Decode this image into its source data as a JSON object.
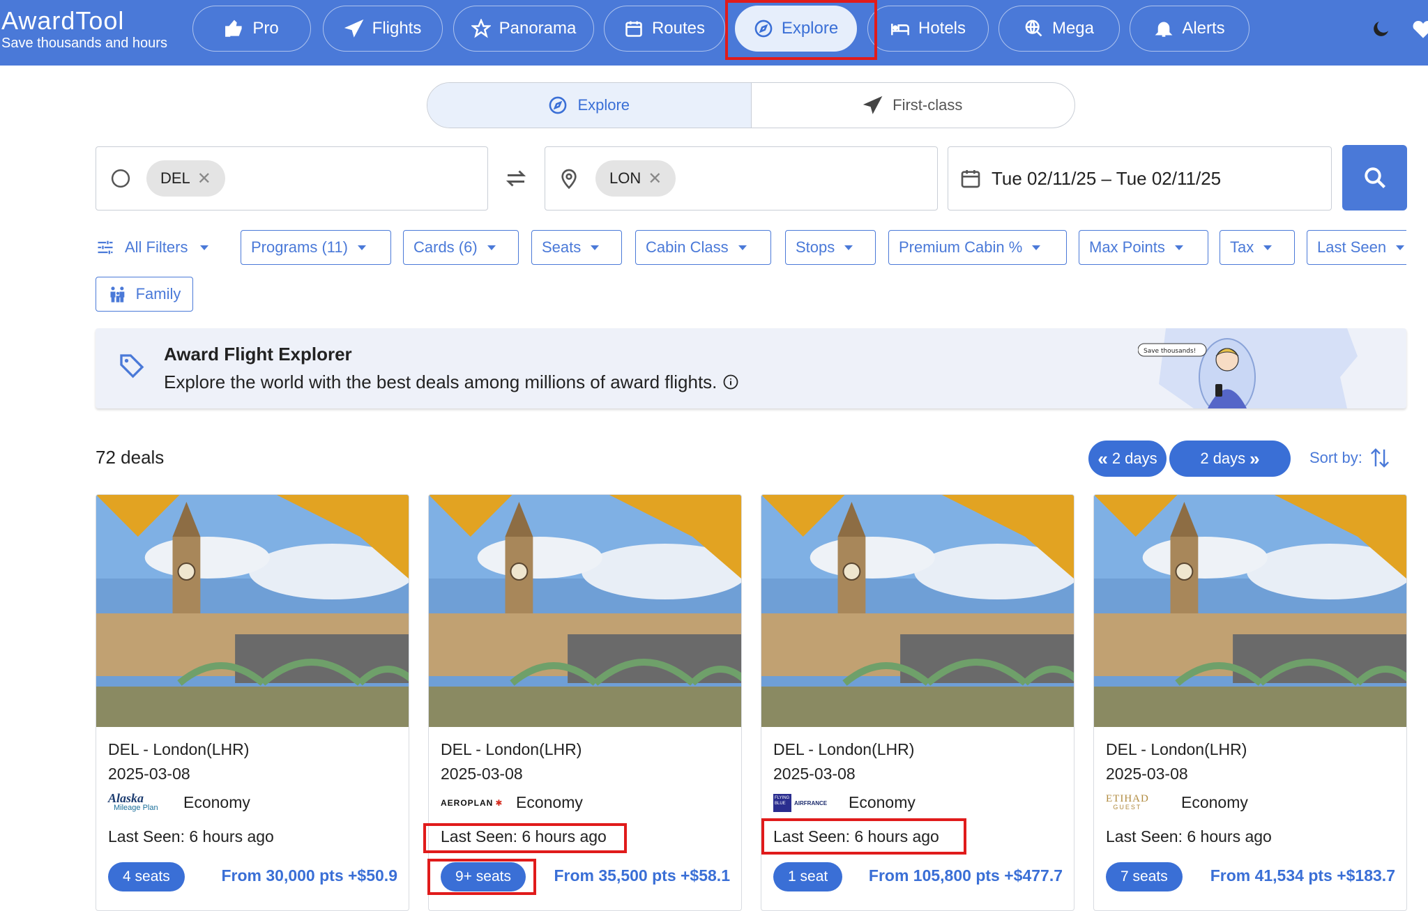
{
  "brand": {
    "title": "AwardTool",
    "subtitle": "Save thousands and hours"
  },
  "nav": [
    {
      "label": "Pro",
      "icon": "thumbs-up-icon"
    },
    {
      "label": "Flights",
      "icon": "plane-icon"
    },
    {
      "label": "Panorama",
      "icon": "star-icon"
    },
    {
      "label": "Routes",
      "icon": "calendar-icon"
    },
    {
      "label": "Explore",
      "icon": "compass-icon",
      "active": true
    },
    {
      "label": "Hotels",
      "icon": "bed-icon"
    },
    {
      "label": "Mega",
      "icon": "globe-search-icon"
    },
    {
      "label": "Alerts",
      "icon": "bell-icon"
    }
  ],
  "mode_toggle": {
    "explore_label": "Explore",
    "first_class_label": "First-class"
  },
  "search": {
    "origin_chip": "DEL",
    "destination_chip": "LON",
    "date_range": "Tue 02/11/25 – Tue 02/11/25"
  },
  "filters": {
    "all_filters": "All Filters",
    "items": [
      "Programs (11)",
      "Cards (6)",
      "Seats",
      "Cabin Class",
      "Stops",
      "Premium Cabin %",
      "Max Points",
      "Tax",
      "Last Seen"
    ],
    "family": "Family"
  },
  "banner": {
    "title": "Award Flight Explorer",
    "description": "Explore the world with the best deals among millions of award flights.",
    "bubble_text": "Save thousands!"
  },
  "deals": {
    "count_label": "72 deals",
    "prev_days": "2 days",
    "next_days": "2 days",
    "sort_label": "Sort by:"
  },
  "cards": [
    {
      "route": "DEL - London(LHR)",
      "date": "2025-03-08",
      "program_logo_text": "Alaska",
      "program_logo_sub": "Mileage Plan",
      "cabin": "Economy",
      "last_seen": "Last Seen: 6 hours ago",
      "seats": "4 seats",
      "price": "From 30,000 pts +$50.9"
    },
    {
      "route": "DEL - London(LHR)",
      "date": "2025-03-08",
      "program_logo_text": "AEROPLAN",
      "program_logo_sub": "",
      "cabin": "Economy",
      "last_seen": "Last Seen: 6 hours ago",
      "seats": "9+ seats",
      "price": "From 35,500 pts +$58.1"
    },
    {
      "route": "DEL - London(LHR)",
      "date": "2025-03-08",
      "program_logo_text": "AIRFRANCE",
      "program_logo_sub": "FLYING BLUE",
      "cabin": "Economy",
      "last_seen": "Last Seen: 6 hours ago",
      "seats": "1 seat",
      "price": "From 105,800 pts +$477.7"
    },
    {
      "route": "DEL - London(LHR)",
      "date": "2025-03-08",
      "program_logo_text": "ETIHAD",
      "program_logo_sub": "GUEST",
      "cabin": "Economy",
      "last_seen": "Last Seen: 6 hours ago",
      "seats": "7 seats",
      "price": "From 41,534 pts +$183.7"
    }
  ],
  "colors": {
    "brand_blue": "#4a79d8",
    "accent_blue": "#3a6fd6",
    "highlight_red": "#e01b1b"
  }
}
